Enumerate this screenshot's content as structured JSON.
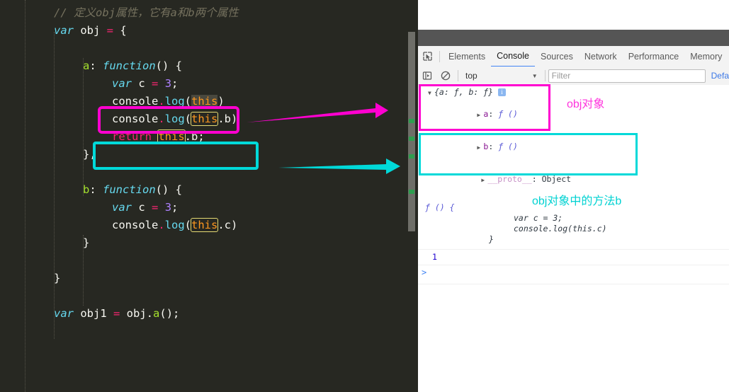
{
  "editor": {
    "lines": [
      {
        "indent": 0,
        "tokens": [
          {
            "t": "// 定义obj属性，它有a和b两个属性",
            "c": "cmt"
          }
        ]
      },
      {
        "indent": 0,
        "tokens": [
          {
            "t": "var",
            "c": "kw"
          },
          {
            "t": " obj ",
            "c": "punct"
          },
          {
            "t": "=",
            "c": "kw2"
          },
          {
            "t": " {",
            "c": "punct"
          }
        ]
      },
      {
        "indent": 0,
        "tokens": []
      },
      {
        "indent": 1,
        "tokens": [
          {
            "t": "a",
            "c": "prop"
          },
          {
            "t": ": ",
            "c": "punct"
          },
          {
            "t": "function",
            "c": "fn"
          },
          {
            "t": "() {",
            "c": "punct"
          }
        ]
      },
      {
        "indent": 2,
        "tokens": [
          {
            "t": "var",
            "c": "kw"
          },
          {
            "t": " c ",
            "c": "punct"
          },
          {
            "t": "=",
            "c": "kw2"
          },
          {
            "t": " ",
            "c": "punct"
          },
          {
            "t": "3",
            "c": "num"
          },
          {
            "t": ";",
            "c": "punct"
          }
        ]
      },
      {
        "indent": 2,
        "tokens": [
          {
            "t": "console",
            "c": "punct"
          },
          {
            "t": ".",
            "c": "dot"
          },
          {
            "t": "log",
            "c": "meth"
          },
          {
            "t": "(",
            "c": "punct"
          },
          {
            "t": "this",
            "c": "this-sel"
          },
          {
            "t": ")",
            "c": "punct"
          }
        ]
      },
      {
        "indent": 2,
        "tokens": [
          {
            "t": "console",
            "c": "punct"
          },
          {
            "t": ".",
            "c": "dot"
          },
          {
            "t": "log",
            "c": "meth"
          },
          {
            "t": "(",
            "c": "punct"
          },
          {
            "t": "this",
            "c": "this-box"
          },
          {
            "t": ".b)",
            "c": "punct"
          }
        ]
      },
      {
        "indent": 2,
        "tokens": [
          {
            "t": "return",
            "c": "kw2"
          },
          {
            "t": " ",
            "c": "punct"
          },
          {
            "t": "this",
            "c": "this-box"
          },
          {
            "t": ".b;",
            "c": "punct"
          }
        ]
      },
      {
        "indent": 1,
        "tokens": [
          {
            "t": "},",
            "c": "punct"
          }
        ]
      },
      {
        "indent": 0,
        "tokens": []
      },
      {
        "indent": 1,
        "tokens": [
          {
            "t": "b",
            "c": "prop"
          },
          {
            "t": ": ",
            "c": "punct"
          },
          {
            "t": "function",
            "c": "fn"
          },
          {
            "t": "() {",
            "c": "punct"
          }
        ]
      },
      {
        "indent": 2,
        "tokens": [
          {
            "t": "var",
            "c": "kw"
          },
          {
            "t": " c ",
            "c": "punct"
          },
          {
            "t": "=",
            "c": "kw2"
          },
          {
            "t": " ",
            "c": "punct"
          },
          {
            "t": "3",
            "c": "num"
          },
          {
            "t": ";",
            "c": "punct"
          }
        ]
      },
      {
        "indent": 2,
        "tokens": [
          {
            "t": "console",
            "c": "punct"
          },
          {
            "t": ".",
            "c": "dot"
          },
          {
            "t": "log",
            "c": "meth"
          },
          {
            "t": "(",
            "c": "punct"
          },
          {
            "t": "this",
            "c": "this-box"
          },
          {
            "t": ".c)",
            "c": "punct"
          }
        ]
      },
      {
        "indent": 1,
        "tokens": [
          {
            "t": "}",
            "c": "punct"
          }
        ]
      },
      {
        "indent": 0,
        "tokens": []
      },
      {
        "indent": 0,
        "tokens": [
          {
            "t": "}",
            "c": "punct"
          }
        ]
      },
      {
        "indent": 0,
        "tokens": []
      },
      {
        "indent": 0,
        "tokens": [
          {
            "t": "var",
            "c": "kw"
          },
          {
            "t": " obj1 ",
            "c": "punct"
          },
          {
            "t": "=",
            "c": "kw2"
          },
          {
            "t": " obj",
            "c": "punct"
          },
          {
            "t": ".",
            "c": "punct"
          },
          {
            "t": "a",
            "c": "prop"
          },
          {
            "t": "();",
            "c": "punct"
          }
        ]
      }
    ],
    "scrollbar_matches": 4
  },
  "devtools": {
    "tabs": [
      {
        "label": "Elements",
        "active": false
      },
      {
        "label": "Console",
        "active": true
      },
      {
        "label": "Sources",
        "active": false
      },
      {
        "label": "Network",
        "active": false
      },
      {
        "label": "Performance",
        "active": false
      },
      {
        "label": "Memory",
        "active": false
      }
    ],
    "inspect_icon": "inspect-cursor-icon",
    "sidebar_icon": "console-sidebar-icon",
    "clear_icon": "clear-console-icon",
    "context": "top",
    "context_caret": "▼",
    "filter_placeholder": "Filter",
    "levels_label": "Defa"
  },
  "console": {
    "messages": [
      {
        "type": "object",
        "triangle": "▼",
        "preview": "{a: ƒ, b: ƒ}",
        "badge": "i",
        "children": [
          {
            "triangle": "▶",
            "key": "a",
            "value": "ƒ ()"
          },
          {
            "triangle": "▶",
            "key": "b",
            "value": "ƒ ()"
          },
          {
            "triangle": "▶",
            "key": "__proto__",
            "value": "Object",
            "is_proto": true
          }
        ]
      },
      {
        "type": "function-source",
        "head": "ƒ () {",
        "body_lines": [
          "var c = 3;",
          "console.log(this.c)"
        ],
        "tail": "}"
      },
      {
        "type": "result",
        "value": "1"
      }
    ],
    "prompt_caret": ">"
  },
  "annotations": {
    "magenta_label": "obj对象",
    "cyan_label": "obj对象中的方法b",
    "magenta_color": "#ff00d0",
    "cyan_color": "#00d9d9"
  }
}
